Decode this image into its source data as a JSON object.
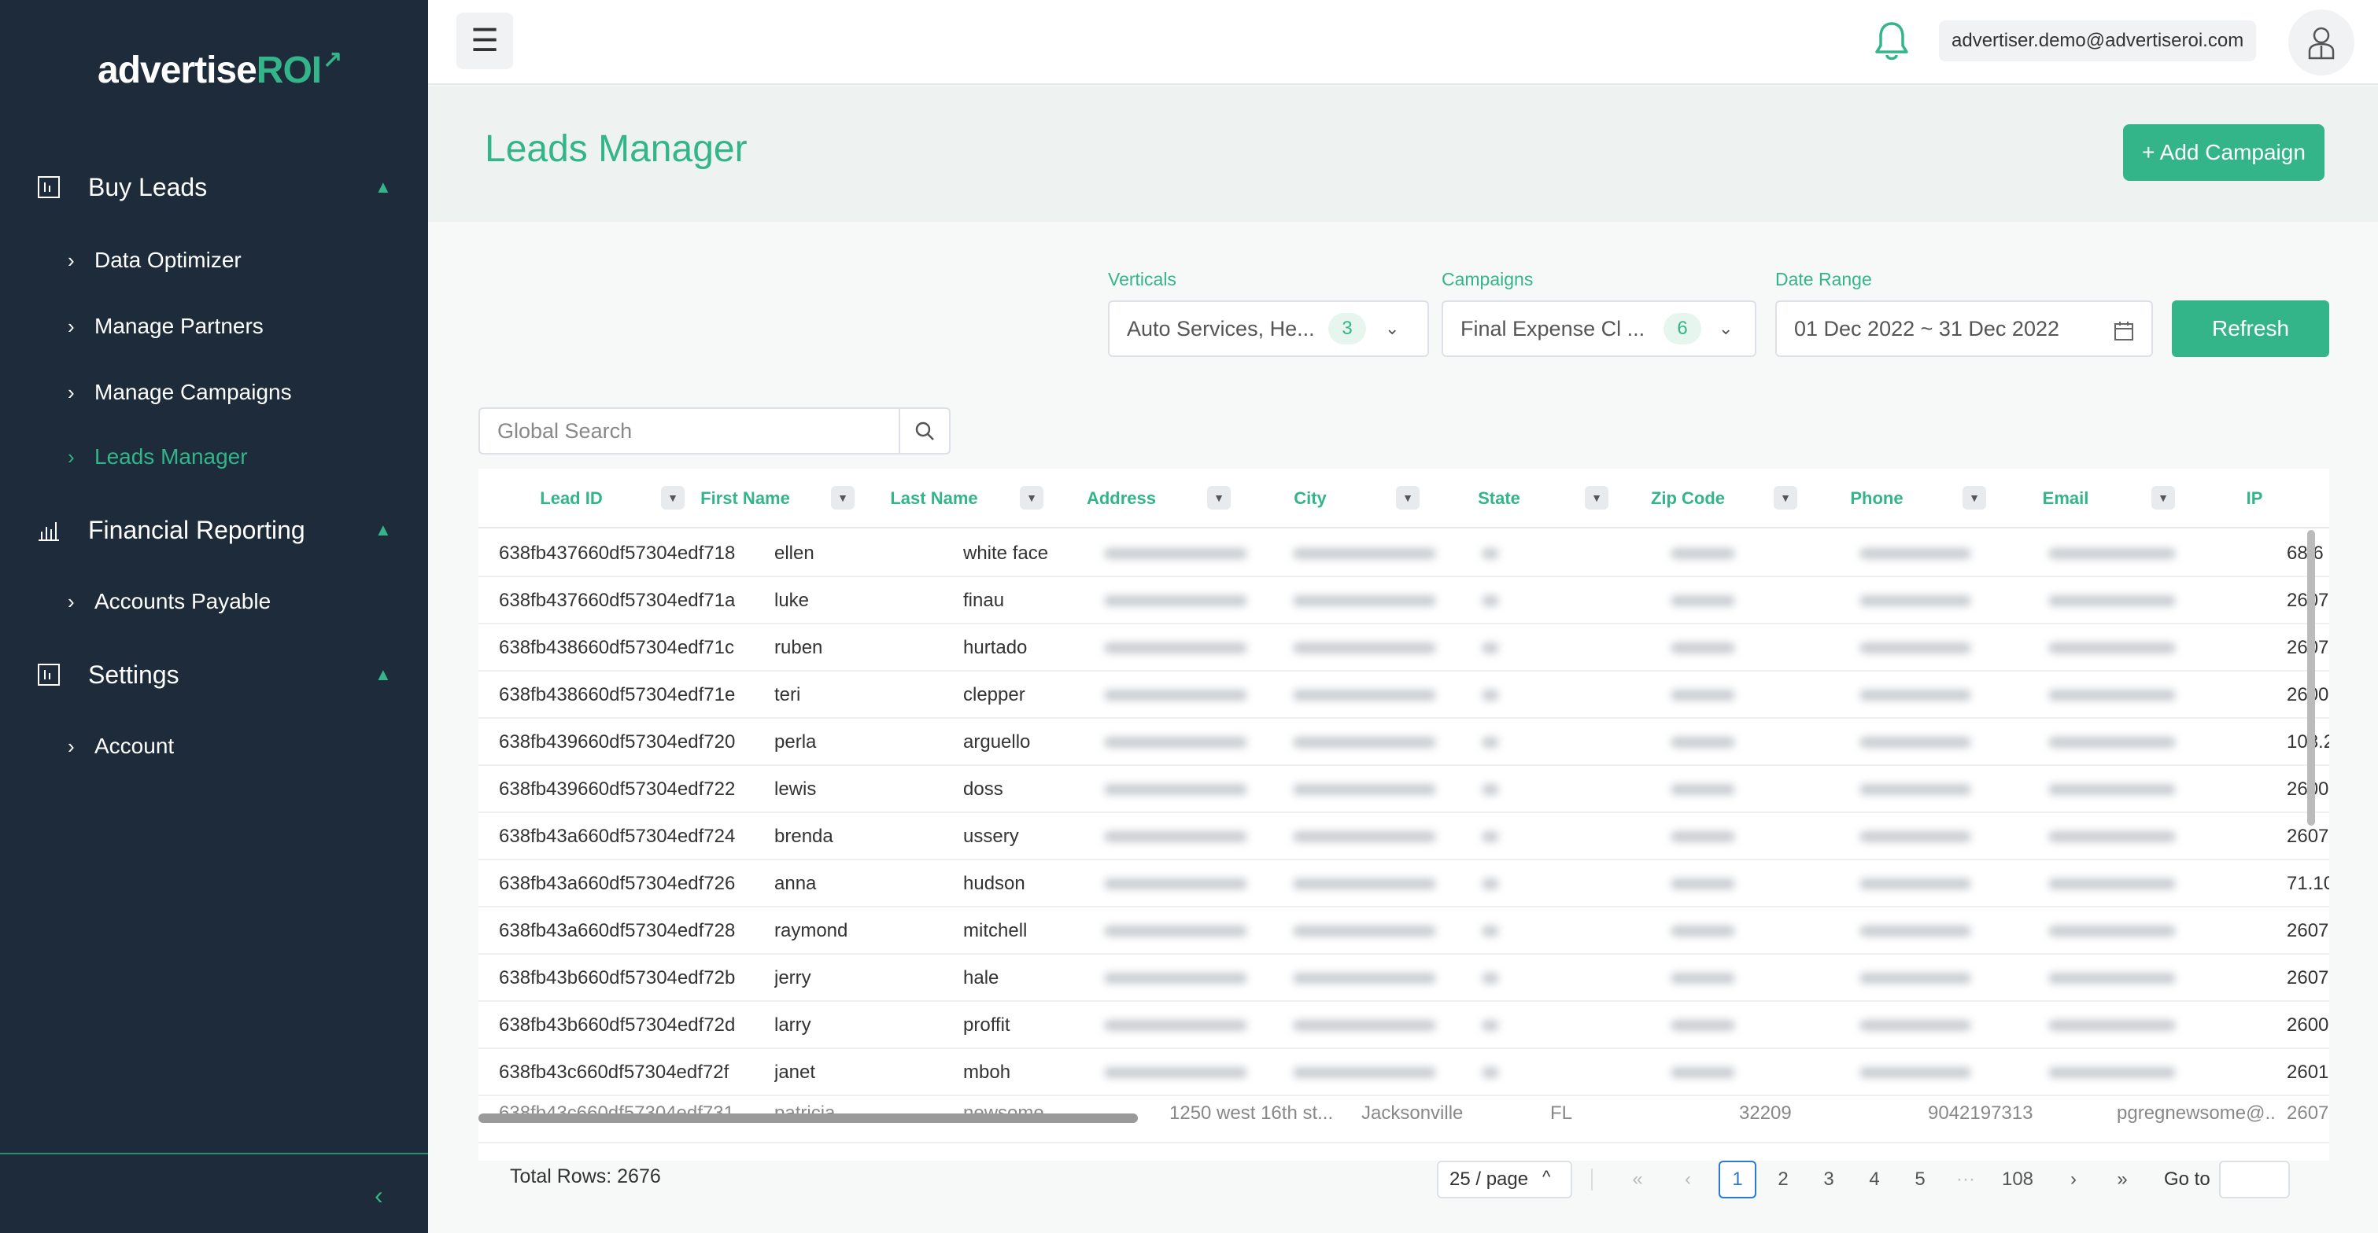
{
  "brand": {
    "name_part1": "advertise",
    "name_part2": "ROI",
    "accent": "#33b589",
    "sidebar_bg": "#1d2b3a"
  },
  "sidebar": {
    "groups": [
      {
        "label": "Buy Leads",
        "icon": "chart-box-icon",
        "items": [
          {
            "label": "Data Optimizer"
          },
          {
            "label": "Manage Partners"
          },
          {
            "label": "Manage Campaigns"
          },
          {
            "label": "Leads Manager",
            "active": true
          }
        ]
      },
      {
        "label": "Financial Reporting",
        "icon": "bar-chart-icon",
        "items": [
          {
            "label": "Accounts Payable"
          }
        ]
      },
      {
        "label": "Settings",
        "icon": "settings-box-icon",
        "items": [
          {
            "label": "Account"
          }
        ]
      }
    ]
  },
  "header": {
    "user_email": "advertiser.demo@advertiseroi.com"
  },
  "page": {
    "title": "Leads Manager",
    "add_button": "+ Add Campaign"
  },
  "filters": {
    "verticals": {
      "label": "Verticals",
      "value": "Auto Services, He...",
      "count": "3"
    },
    "campaigns": {
      "label": "Campaigns",
      "value": "Final Expense Cl ...",
      "count": "6"
    },
    "date_range": {
      "label": "Date Range",
      "value": "01 Dec 2022 ~ 31 Dec 2022"
    },
    "refresh": "Refresh"
  },
  "search": {
    "placeholder": "Global Search"
  },
  "table": {
    "columns": [
      "Lead ID",
      "First Name",
      "Last Name",
      "Address",
      "City",
      "State",
      "Zip Code",
      "Phone",
      "Email",
      "IP"
    ],
    "rows": [
      [
        "638fb437660df57304edf718",
        "ellen",
        "white face",
        "68.6"
      ],
      [
        "638fb437660df57304edf71a",
        "luke",
        "finau",
        "2607"
      ],
      [
        "638fb438660df57304edf71c",
        "ruben",
        "hurtado",
        "2607"
      ],
      [
        "638fb438660df57304edf71e",
        "teri",
        "clepper",
        "2600"
      ],
      [
        "638fb439660df57304edf720",
        "perla",
        "arguello",
        "108.2"
      ],
      [
        "638fb439660df57304edf722",
        "lewis",
        "doss",
        "2600"
      ],
      [
        "638fb43a660df57304edf724",
        "brenda",
        "ussery",
        "2607"
      ],
      [
        "638fb43a660df57304edf726",
        "anna",
        "hudson",
        "71.10"
      ],
      [
        "638fb43a660df57304edf728",
        "raymond",
        "mitchell",
        "2607"
      ],
      [
        "638fb43b660df57304edf72b",
        "jerry",
        "hale",
        "2607"
      ],
      [
        "638fb43b660df57304edf72d",
        "larry",
        "proffit",
        "2600"
      ],
      [
        "638fb43c660df57304edf72f",
        "janet",
        "mboh",
        "2601"
      ]
    ],
    "last_row": {
      "lead_id": "638fb43c660df57304edf731",
      "first_name": "patricia",
      "last_name": "newsome",
      "address": "1250 west 16th st...",
      "city": "Jacksonville",
      "state": "FL",
      "zip": "32209",
      "phone": "9042197313",
      "email": "pgregnewsome@...",
      "ip": "2607"
    }
  },
  "pagination": {
    "total_rows": "Total Rows: 2676",
    "page_size": "25 / page",
    "pages": [
      "1",
      "2",
      "3",
      "4",
      "5",
      "···",
      "108"
    ],
    "current": "1",
    "goto_label": "Go to"
  }
}
